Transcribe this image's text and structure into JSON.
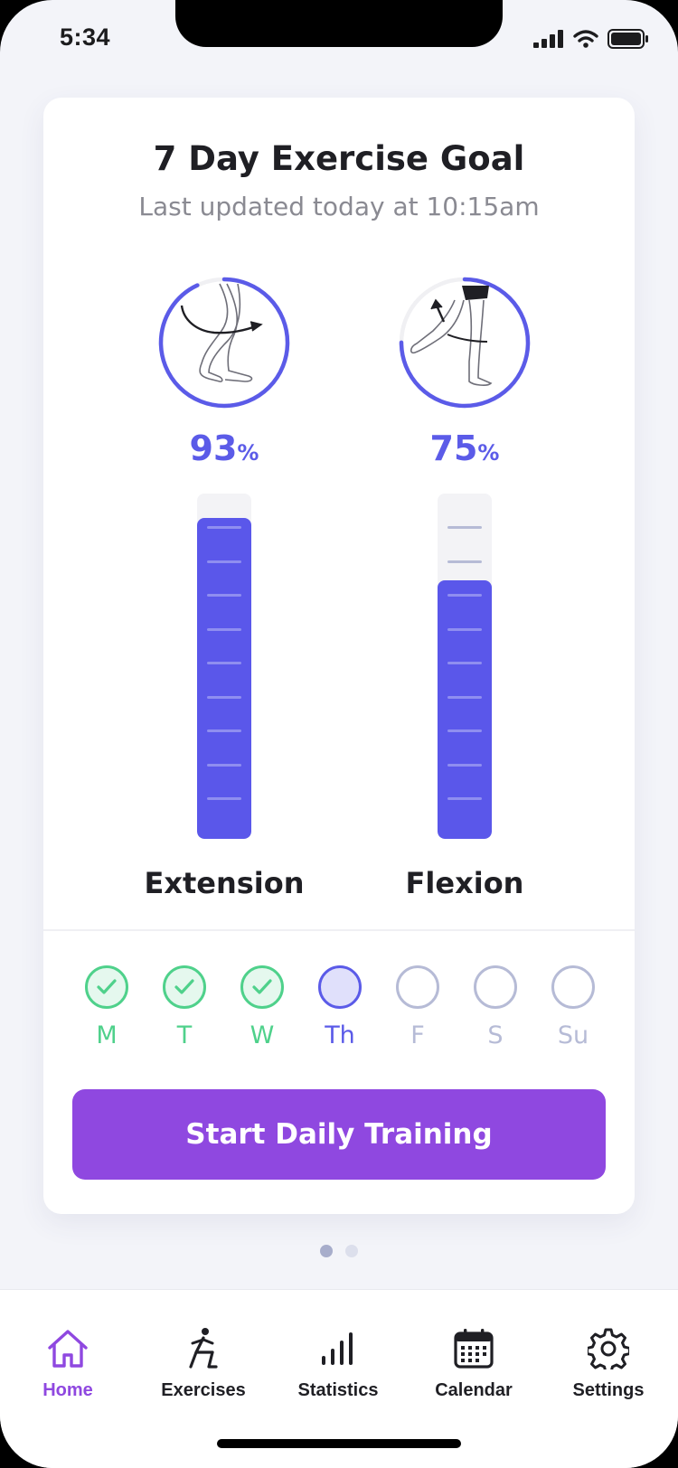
{
  "status_bar": {
    "time": "5:34"
  },
  "card": {
    "title": "7 Day Exercise Goal",
    "subtitle": "Last updated today at 10:15am"
  },
  "metrics": [
    {
      "label": "Extension",
      "percent": "93",
      "percent_symbol": "%",
      "value": 0.93,
      "icon": "leg-extension-icon"
    },
    {
      "label": "Flexion",
      "percent": "75",
      "percent_symbol": "%",
      "value": 0.75,
      "icon": "leg-flexion-icon"
    }
  ],
  "days": [
    {
      "label": "M",
      "state": "done"
    },
    {
      "label": "T",
      "state": "done"
    },
    {
      "label": "W",
      "state": "done"
    },
    {
      "label": "Th",
      "state": "today"
    },
    {
      "label": "F",
      "state": "pending"
    },
    {
      "label": "S",
      "state": "pending"
    },
    {
      "label": "Su",
      "state": "pending"
    }
  ],
  "start_button": {
    "label": "Start Daily Training"
  },
  "pager": {
    "pages": 2,
    "current": 1
  },
  "tabs": [
    {
      "label": "Home",
      "icon": "home-icon",
      "active": true
    },
    {
      "label": "Exercises",
      "icon": "exercise-icon",
      "active": false
    },
    {
      "label": "Statistics",
      "icon": "statistics-icon",
      "active": false
    },
    {
      "label": "Calendar",
      "icon": "calendar-icon",
      "active": false
    },
    {
      "label": "Settings",
      "icon": "gear-icon",
      "active": false
    }
  ],
  "colors": {
    "accent": "#5b5be8",
    "button": "#8f48e0",
    "done": "#4fd18b",
    "pending": "#b6bbd6"
  }
}
